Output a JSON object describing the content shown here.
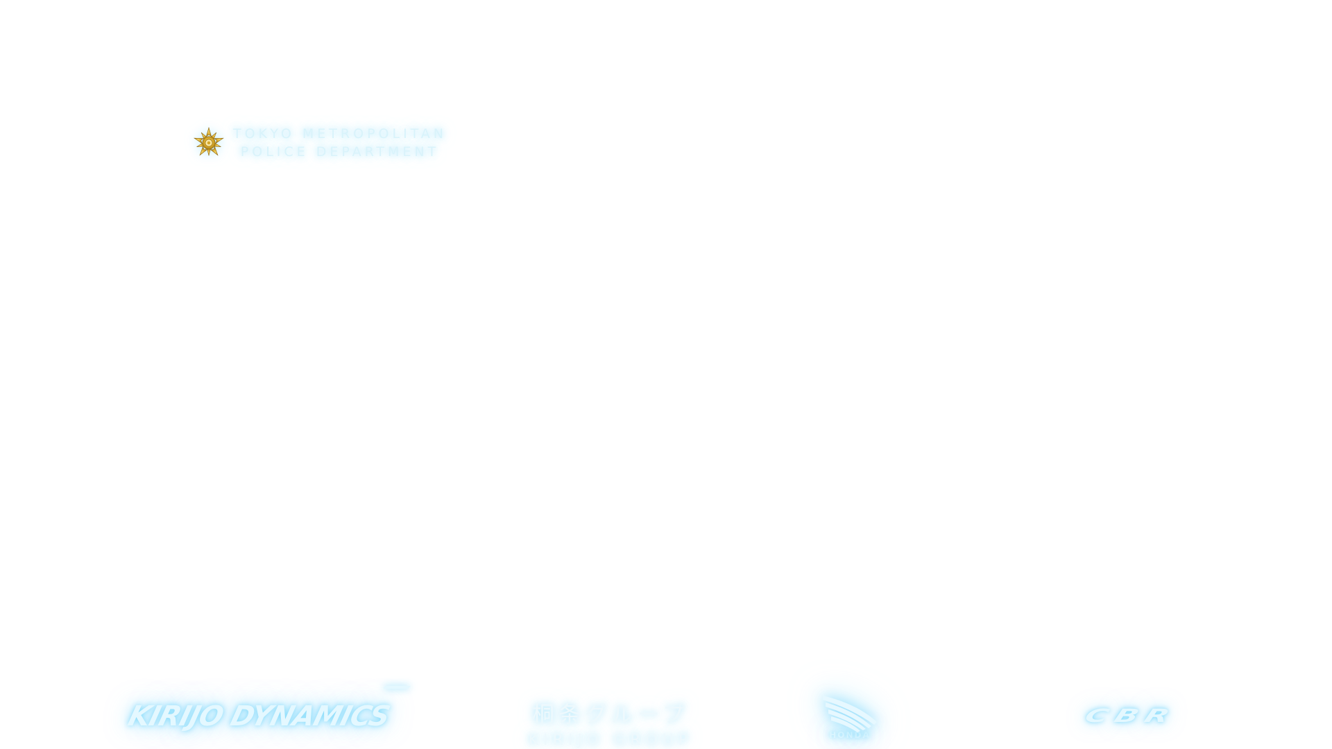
{
  "badge": {
    "emblem_icon": "police-star-emblem-icon",
    "line1": "TOKYO METROPOLITAN",
    "line2": "POLICE DEPARTMENT",
    "emblem_color": "#d4a62a"
  },
  "sponsors": {
    "kirijo_dynamics": "KIRIJO DYNAMICS",
    "kirijo_group_jp": "桐条グループ",
    "kirijo_group_en": "KIRIJO GROUP",
    "honda_icon": "honda-wing-icon",
    "honda": "HONDA",
    "cbr": "CBR",
    "glow_color": "#9edcf5"
  }
}
